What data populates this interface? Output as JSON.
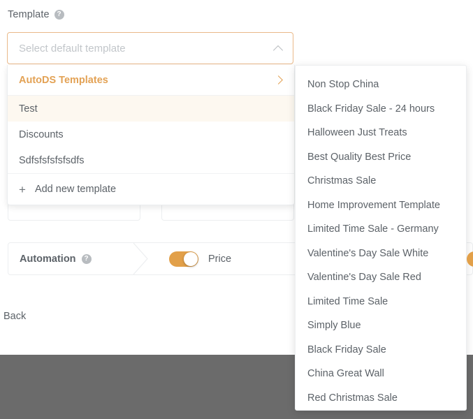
{
  "field": {
    "label": "Template",
    "help_icon": "question-mark-circle-icon",
    "placeholder": "Select default template",
    "chevron_icon": "chevron-up-icon"
  },
  "dropdown": {
    "group_header": {
      "label": "AutoDS Templates",
      "chevron_icon": "chevron-right-icon",
      "color": "#e3a255"
    },
    "items": [
      {
        "label": "Test",
        "selected": true
      },
      {
        "label": "Discounts",
        "selected": false
      },
      {
        "label": "Sdfsfsfsfsfsdfs",
        "selected": false
      }
    ],
    "add_new": {
      "label": "Add new template",
      "icon": "plus-icon"
    },
    "highlight_color": "#fdf8f0"
  },
  "submenu": {
    "items": [
      "Non Stop China",
      "Black Friday Sale - 24 hours",
      "Halloween Just Treats",
      "Best Quality Best Price",
      "Christmas Sale",
      "Home Improvement Template",
      "Limited Time Sale - Germany",
      "Valentine's Day Sale White",
      "Valentine's Day Sale Red",
      "Limited Time Sale",
      "Simply Blue",
      "Black Friday Sale",
      "China Great Wall",
      "Red Christmas Sale"
    ]
  },
  "automation": {
    "label": "Automation",
    "help_icon": "question-mark-circle-icon",
    "price_label": "Price",
    "price_toggle_on": true,
    "toggle_color": "#e2a049"
  },
  "footer": {
    "back_label": "Back"
  }
}
